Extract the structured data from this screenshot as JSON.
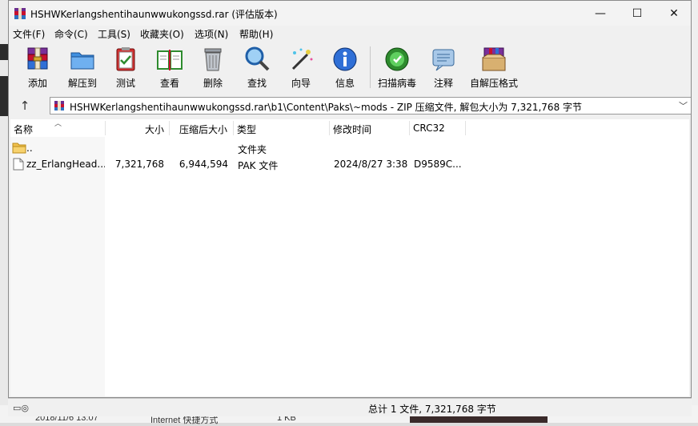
{
  "window": {
    "title": "HSHWKerlangshentihaunwwukongssd.rar (评估版本)",
    "minimize_glyph": "—",
    "maximize_glyph": "☐",
    "close_glyph": "✕"
  },
  "menu": [
    "文件(F)",
    "命令(C)",
    "工具(S)",
    "收藏夹(O)",
    "选项(N)",
    "帮助(H)"
  ],
  "toolbar": [
    {
      "label": "添加",
      "icon": "add-archive-icon"
    },
    {
      "label": "解压到",
      "icon": "extract-folder-icon"
    },
    {
      "label": "测试",
      "icon": "test-clipboard-icon"
    },
    {
      "label": "查看",
      "icon": "view-book-icon"
    },
    {
      "label": "删除",
      "icon": "trash-icon"
    },
    {
      "label": "查找",
      "icon": "magnifier-icon"
    },
    {
      "label": "向导",
      "icon": "wizard-wand-icon"
    },
    {
      "label": "信息",
      "icon": "info-icon"
    },
    {
      "label": "扫描病毒",
      "icon": "virus-scan-icon"
    },
    {
      "label": "注释",
      "icon": "comment-icon"
    },
    {
      "label": "自解压格式",
      "icon": "sfx-box-icon"
    }
  ],
  "address": {
    "path": "HSHWKerlangshentihaunwwukongssd.rar\\b1\\Content\\Paks\\~mods - ZIP 压缩文件, 解包大小为 7,321,768 字节",
    "up_glyph": "↑"
  },
  "columns": [
    "名称",
    "大小",
    "压缩后大小",
    "类型",
    "修改时间",
    "CRC32"
  ],
  "rows": [
    {
      "name": "..",
      "size": "",
      "packed": "",
      "type": "文件夹",
      "modified": "",
      "crc": "",
      "icon": "folder-icon"
    },
    {
      "name": "zz_ErlangHead...",
      "size": "7,321,768",
      "packed": "6,944,594",
      "type": "PAK 文件",
      "modified": "2024/8/27 3:38",
      "crc": "D9589C...",
      "icon": "file-icon"
    }
  ],
  "status": {
    "text": "总计 1 文件, 7,321,768 字节"
  },
  "background": {
    "bottom_text_1": "2018/11/6 13:07",
    "bottom_text_2": "Internet 快捷方式",
    "bottom_text_3": "1 KB"
  },
  "colors": {
    "accent_red": "#c8102e",
    "folder_yellow": "#f2c14e",
    "blue": "#2f6fd6",
    "green": "#2e8b2e"
  }
}
